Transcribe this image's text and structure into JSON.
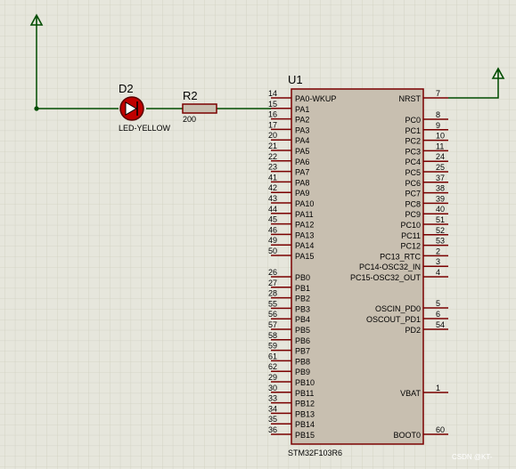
{
  "colors": {
    "background": "#e6e6dc",
    "grid": "#cfcfc0",
    "grid_major": "#bcbcae",
    "wire": "#004c00",
    "component_body": "#c8bfb0",
    "component_outline": "#7a0000",
    "pin": "#7a0000",
    "text": "#000000",
    "led_fill": "#c00000"
  },
  "schematic": {
    "mcu": {
      "ref": "U1",
      "part": "STM32F103R6",
      "left_pins": [
        {
          "num": "14",
          "name": "PA0-WKUP"
        },
        {
          "num": "15",
          "name": "PA1"
        },
        {
          "num": "16",
          "name": "PA2"
        },
        {
          "num": "17",
          "name": "PA3"
        },
        {
          "num": "20",
          "name": "PA4"
        },
        {
          "num": "21",
          "name": "PA5"
        },
        {
          "num": "22",
          "name": "PA6"
        },
        {
          "num": "23",
          "name": "PA7"
        },
        {
          "num": "41",
          "name": "PA8"
        },
        {
          "num": "42",
          "name": "PA9"
        },
        {
          "num": "43",
          "name": "PA10"
        },
        {
          "num": "44",
          "name": "PA11"
        },
        {
          "num": "45",
          "name": "PA12"
        },
        {
          "num": "46",
          "name": "PA13"
        },
        {
          "num": "49",
          "name": "PA14"
        },
        {
          "num": "50",
          "name": "PA15"
        },
        {
          "num": "26",
          "name": "PB0"
        },
        {
          "num": "27",
          "name": "PB1"
        },
        {
          "num": "28",
          "name": "PB2"
        },
        {
          "num": "55",
          "name": "PB3"
        },
        {
          "num": "56",
          "name": "PB4"
        },
        {
          "num": "57",
          "name": "PB5"
        },
        {
          "num": "58",
          "name": "PB6"
        },
        {
          "num": "59",
          "name": "PB7"
        },
        {
          "num": "61",
          "name": "PB8"
        },
        {
          "num": "62",
          "name": "PB9"
        },
        {
          "num": "29",
          "name": "PB10"
        },
        {
          "num": "30",
          "name": "PB11"
        },
        {
          "num": "33",
          "name": "PB12"
        },
        {
          "num": "34",
          "name": "PB13"
        },
        {
          "num": "35",
          "name": "PB14"
        },
        {
          "num": "36",
          "name": "PB15"
        }
      ],
      "right_pins": [
        {
          "num": "7",
          "name": "NRST"
        },
        {
          "num": "8",
          "name": "PC0"
        },
        {
          "num": "9",
          "name": "PC1"
        },
        {
          "num": "10",
          "name": "PC2"
        },
        {
          "num": "11",
          "name": "PC3"
        },
        {
          "num": "24",
          "name": "PC4"
        },
        {
          "num": "25",
          "name": "PC5"
        },
        {
          "num": "37",
          "name": "PC6"
        },
        {
          "num": "38",
          "name": "PC7"
        },
        {
          "num": "39",
          "name": "PC8"
        },
        {
          "num": "40",
          "name": "PC9"
        },
        {
          "num": "51",
          "name": "PC10"
        },
        {
          "num": "52",
          "name": "PC11"
        },
        {
          "num": "53",
          "name": "PC12"
        },
        {
          "num": "2",
          "name": "PC13_RTC"
        },
        {
          "num": "3",
          "name": "PC14-OSC32_IN"
        },
        {
          "num": "4",
          "name": "PC15-OSC32_OUT"
        },
        {
          "num": "5",
          "name": "OSCIN_PD0"
        },
        {
          "num": "6",
          "name": "OSCOUT_PD1"
        },
        {
          "num": "54",
          "name": "PD2"
        },
        {
          "num": "1",
          "name": "VBAT"
        },
        {
          "num": "60",
          "name": "BOOT0"
        }
      ]
    },
    "led": {
      "ref": "D2",
      "value": "LED-YELLOW"
    },
    "resistor": {
      "ref": "R2",
      "value": "200"
    }
  },
  "watermark": "CSDN @KT-"
}
